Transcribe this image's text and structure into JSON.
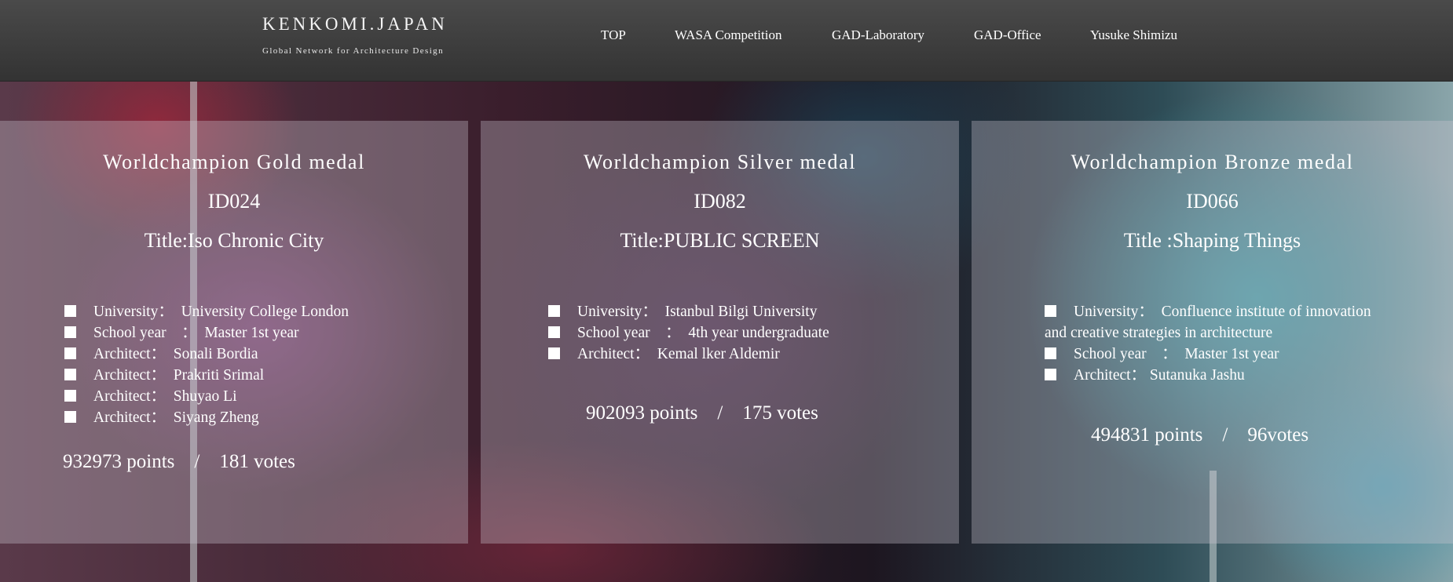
{
  "header": {
    "logo_title": "KENKOMI.JAPAN",
    "logo_subtitle": "Global Network for Architecture Design",
    "nav": [
      {
        "label": "TOP"
      },
      {
        "label": "WASA Competition"
      },
      {
        "label": "GAD-Laboratory"
      },
      {
        "label": "GAD-Office"
      },
      {
        "label": "Yusuke Shimizu"
      }
    ]
  },
  "panels": [
    {
      "medal": "Worldchampion Gold medal",
      "id": "ID024",
      "title": "Title:Iso Chronic City",
      "details": [
        "University：　University College London",
        "School year　：　Master  1st year",
        "Architect：　Sonali Bordia",
        "Architect：　Prakriti Srimal",
        "Architect：　Shuyao Li",
        "Architect：　Siyang Zheng"
      ],
      "score": "932973 points　/　181 votes"
    },
    {
      "medal": "Worldchampion Silver medal",
      "id": "ID082",
      "title": "Title:PUBLIC SCREEN",
      "details": [
        "University：　Istanbul Bilgi University",
        "School year　：　4th year undergraduate",
        "Architect：　Kemal lker Aldemir"
      ],
      "score": "902093 points　/　175 votes"
    },
    {
      "medal": "Worldchampion Bronze medal",
      "id": "ID066",
      "title": "Title :Shaping Things",
      "details": [
        "University：　Confluence institute of innovation and creative strategies in architecture",
        "School year　：　Master  1st year",
        "Architect：  Sutanuka Jashu"
      ],
      "score": "494831 points　/　96votes"
    }
  ],
  "colors": {
    "header_bg": "#3c3c3c",
    "panel_overlay": "rgba(205,200,210,0.34)",
    "text": "#ffffff"
  }
}
